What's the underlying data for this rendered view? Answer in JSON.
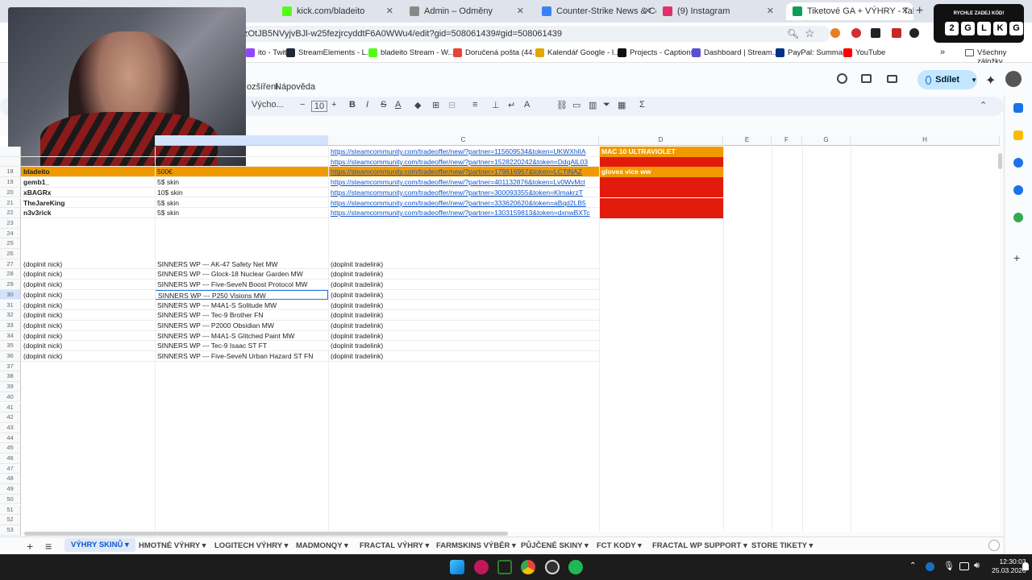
{
  "browser": {
    "tabs": [
      {
        "title": "kick.com/bladeito",
        "color": "#53fc18"
      },
      {
        "title": "Admin – Odměny",
        "color": "#888888"
      },
      {
        "title": "Counter-Strike News & Coverag",
        "color": "#3b82f6"
      },
      {
        "title": "(9) Instagram",
        "color": "#e1306c"
      },
      {
        "title": "Tiketové GA + VÝHRY - Tabulk",
        "color": "#0f9d58"
      }
    ],
    "url": "zOtJB5NVyjvBJl-w25fezjrcyddtF6A0WWu4/edit?gid=508061439#gid=508061439",
    "bookmarks": [
      {
        "label": "ito - Twitch",
        "color": "#9146ff"
      },
      {
        "label": "StreamElements - L...",
        "color": "#1f2937"
      },
      {
        "label": "bladeito Stream - W...",
        "color": "#53fc18"
      },
      {
        "label": "Doručená pošta (44...",
        "color": "#ea4335"
      },
      {
        "label": "Kalendář Google - I...",
        "color": "#e0a800"
      },
      {
        "label": "Projects - Captions",
        "color": "#111111"
      },
      {
        "label": "Dashboard | Stream...",
        "color": "#5b4fd6"
      },
      {
        "label": "PayPal: Summary",
        "color": "#003087"
      },
      {
        "label": "YouTube",
        "color": "#ff0000"
      }
    ],
    "all_bookmarks": "Všechny záložky"
  },
  "code_overlay": {
    "title": "RYCHLE ZADEJ KÓD!",
    "letters": [
      "2",
      "G",
      "L",
      "K",
      "G"
    ]
  },
  "sheets": {
    "menu": [
      "ozšíření",
      "Nápověda"
    ],
    "share_label": "Sdílet",
    "font_name": "Výcho...",
    "font_size": "10",
    "columns": [
      "C",
      "D",
      "E",
      "F",
      "G",
      "H"
    ],
    "rows_top": [
      {
        "num": "",
        "a": "",
        "b": "",
        "c": "https://steamcommunity.com/tradeoffer/new/?partner=115609534&token=UKWXhlIA",
        "d": "MAC 10 ULTRAVIOLET",
        "dcolor": "#f19a00"
      },
      {
        "num": "",
        "a": "",
        "b": "",
        "c": "https://steamcommunity.com/tradeoffer/new/?partner=1528220242&token=DdqAlL03",
        "d": "",
        "dcolor": "#e31b0c"
      },
      {
        "num": "18",
        "a": "bladeito",
        "b": "500€",
        "c": "https://steamcommunity.com/tradeoffer/new/?partner=179616957&token=LCTlNAZ",
        "d": "gloves vice ww",
        "dcolor": "#f19a00",
        "rowcolor": "#f19a00"
      },
      {
        "num": "19",
        "a": "gemb1_",
        "b": "5$ skin",
        "c": "https://steamcommunity.com/tradeoffer/new/?partner=401132876&token=Lv0WvMcl",
        "d": "",
        "dcolor": "#e31b0c"
      },
      {
        "num": "20",
        "a": "xBAGRx",
        "b": "10$ skin",
        "c": "https://steamcommunity.com/tradeoffer/new/?partner=300093355&token=KlmakrzT",
        "d": "",
        "dcolor": "#e31b0c"
      },
      {
        "num": "21",
        "a": "TheJareKing",
        "b": "5$ skin",
        "c": "https://steamcommunity.com/tradeoffer/new/?partner=333620620&token=aBqd2LB5",
        "d": "",
        "dcolor": "#e31b0c"
      },
      {
        "num": "22",
        "a": "n3v3rick",
        "b": "5$ skin",
        "c": "https://steamcommunity.com/tradeoffer/new/?partner=1303159813&token=dxnwBXTc",
        "d": "",
        "dcolor": "#e31b0c"
      }
    ],
    "rows_mid": [
      {
        "num": "27",
        "a": "(doplnit nick)",
        "b": "SINNERS WP --- AK-47 Safety Net MW",
        "c": "(doplnit tradelink)"
      },
      {
        "num": "28",
        "a": "(doplnit nick)",
        "b": "SINNERS WP --- Glock-18 Nuclear Garden MW",
        "c": "(doplnit tradelink)"
      },
      {
        "num": "29",
        "a": "(doplnit nick)",
        "b": "SINNERS WP --- Five-SeveN Boost Protocol MW",
        "c": "(doplnit tradelink)"
      },
      {
        "num": "30",
        "a": "(doplnit nick)",
        "b": "SINNERS WP --- P250 Visions MW",
        "c": "(doplnit tradelink)"
      },
      {
        "num": "31",
        "a": "(doplnit nick)",
        "b": "SINNERS WP --- M4A1-S Solitude MW",
        "c": "(doplnit tradelink)"
      },
      {
        "num": "32",
        "a": "(doplnit nick)",
        "b": "SINNERS WP --- Tec-9 Brother FN",
        "c": "(doplnit tradelink)"
      },
      {
        "num": "33",
        "a": "(doplnit nick)",
        "b": "SINNERS WP --- P2000 Obsidian MW",
        "c": "(doplnit tradelink)"
      },
      {
        "num": "34",
        "a": "(doplnit nick)",
        "b": "SINNERS WP --- M4A1-S Glitched Paint MW",
        "c": "(doplnit tradelink)"
      },
      {
        "num": "35",
        "a": "(doplnit nick)",
        "b": "SINNERS WP --- Tec-9 Isaac ST FT",
        "c": "(doplnit tradelink)"
      },
      {
        "num": "36",
        "a": "(doplnit nick)",
        "b": "SINNERS WP --- Five-SeveN Urban Hazard ST FN",
        "c": "(doplnit tradelink)"
      }
    ],
    "empty_rows_before": [
      "23",
      "24",
      "25",
      "26"
    ],
    "empty_rows_after": [
      "37",
      "38",
      "39",
      "40",
      "41",
      "42",
      "43",
      "44",
      "45",
      "46",
      "47",
      "48",
      "49",
      "50",
      "51",
      "52",
      "53"
    ],
    "sheet_tabs": [
      "VÝHRY SKINŮ",
      "HMOTNÉ VÝHRY",
      "LOGITECH VÝHRY",
      "MADMONQY",
      "FRACTAL VÝHRY",
      "FARMSKINS VÝBĚR",
      "PŮJČENÉ SKINY",
      "FCT KODY",
      "FRACTAL WP SUPPORT",
      "STORE TIKETY"
    ]
  },
  "taskbar": {
    "time": "12:30:03",
    "date": "25.03.2026"
  }
}
